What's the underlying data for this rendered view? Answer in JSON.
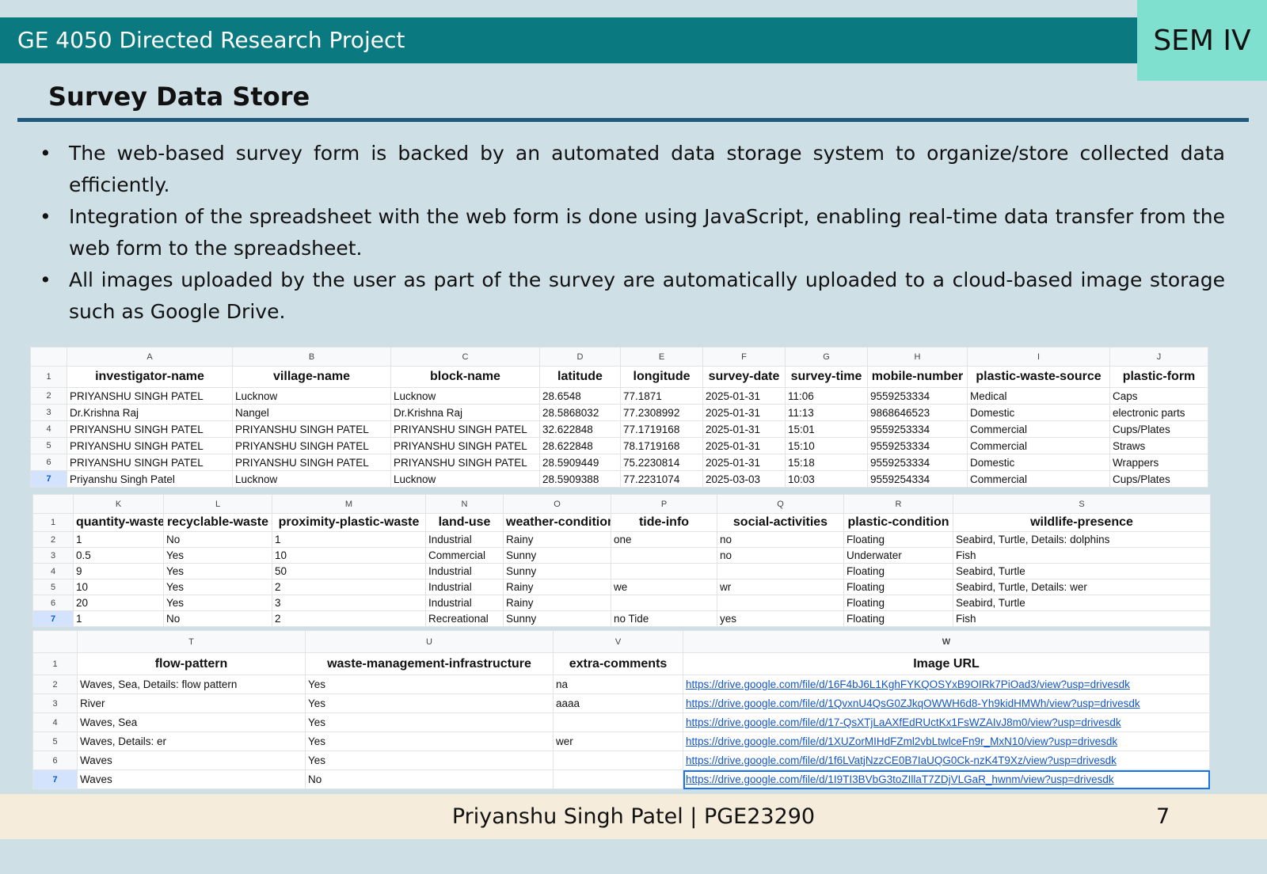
{
  "header": {
    "course": "GE 4050 Directed Research Project",
    "sem": "SEM IV"
  },
  "slide_title": "Survey Data Store",
  "bullets": [
    "The web-based survey form is backed by an automated data storage system to organize/store collected data efficiently.",
    "Integration of the spreadsheet with the web form is done using JavaScript, enabling real-time data transfer from the web form to the spreadsheet.",
    "All images uploaded by the user as part of the survey are automatically uploaded to a cloud-based image storage such as Google Drive."
  ],
  "bullet_char": "•",
  "sheet1": {
    "cols": [
      "A",
      "B",
      "C",
      "D",
      "E",
      "F",
      "G",
      "H",
      "I",
      "J"
    ],
    "headers": [
      "investigator-name",
      "village-name",
      "block-name",
      "latitude",
      "longitude",
      "survey-date",
      "survey-time",
      "mobile-number",
      "plastic-waste-source",
      "plastic-form"
    ],
    "rows": [
      [
        "PRIYANSHU SINGH PATEL",
        "Lucknow",
        "Lucknow",
        "28.6548",
        "77.1871",
        "2025-01-31",
        "11:06",
        "9559253334",
        "Medical",
        "Caps"
      ],
      [
        "Dr.Krishna Raj",
        "Nangel",
        "Dr.Krishna Raj",
        "28.5868032",
        "77.2308992",
        "2025-01-31",
        "11:13",
        "9868646523",
        "Domestic",
        "electronic parts"
      ],
      [
        "PRIYANSHU SINGH PATEL",
        "PRIYANSHU SINGH PATEL",
        "PRIYANSHU SINGH PATEL",
        "32.622848",
        "77.1719168",
        "2025-01-31",
        "15:01",
        "9559253334",
        "Commercial",
        "Cups/Plates"
      ],
      [
        "PRIYANSHU SINGH PATEL",
        "PRIYANSHU SINGH PATEL",
        "PRIYANSHU SINGH PATEL",
        "28.622848",
        "78.1719168",
        "2025-01-31",
        "15:10",
        "9559253334",
        "Commercial",
        "Straws"
      ],
      [
        "PRIYANSHU SINGH PATEL",
        "PRIYANSHU SINGH PATEL",
        "PRIYANSHU SINGH PATEL",
        "28.5909449",
        "75.2230814",
        "2025-01-31",
        "15:18",
        "9559253334",
        "Domestic",
        "Wrappers"
      ],
      [
        "Priyanshu Singh Patel",
        "Lucknow",
        "Lucknow",
        "28.5909388",
        "77.2231074",
        "2025-03-03",
        "10:03",
        "9559254334",
        "Commercial",
        "Cups/Plates"
      ]
    ]
  },
  "sheet2": {
    "cols": [
      "K",
      "L",
      "M",
      "N",
      "O",
      "P",
      "Q",
      "R",
      "S"
    ],
    "headers": [
      "quantity-waste",
      "recyclable-waste",
      "proximity-plastic-waste",
      "land-use",
      "weather-condition",
      "tide-info",
      "social-activities",
      "plastic-condition",
      "wildlife-presence"
    ],
    "rows": [
      [
        "1",
        "No",
        "1",
        "Industrial",
        "Rainy",
        "one",
        "no",
        "Floating",
        "Seabird, Turtle, Details: dolphins"
      ],
      [
        "0.5",
        "Yes",
        "10",
        "Commercial",
        "Sunny",
        "",
        "no",
        "Underwater",
        "Fish"
      ],
      [
        "9",
        "Yes",
        "50",
        "Industrial",
        "Sunny",
        "",
        "",
        "Floating",
        "Seabird, Turtle"
      ],
      [
        "10",
        "Yes",
        "2",
        "Industrial",
        "Rainy",
        "we",
        "wr",
        "Floating",
        "Seabird, Turtle, Details: wer"
      ],
      [
        "20",
        "Yes",
        "3",
        "Industrial",
        "Rainy",
        "",
        "",
        "Floating",
        "Seabird, Turtle"
      ],
      [
        "1",
        "No",
        "2",
        "Recreational",
        "Sunny",
        "no Tide",
        "yes",
        "Floating",
        "Fish"
      ]
    ]
  },
  "sheet3": {
    "cols": [
      "T",
      "U",
      "V",
      "W"
    ],
    "headers": [
      "flow-pattern",
      "waste-management-infrastructure",
      "extra-comments",
      "Image URL"
    ],
    "rows": [
      [
        "Waves, Sea, Details: flow pattern",
        "Yes",
        "na",
        "https://drive.google.com/file/d/16F4bJ6L1KghFYKQOSYxB9OIRk7PiOad3/view?usp=drivesdk"
      ],
      [
        "River",
        "Yes",
        "aaaa",
        "https://drive.google.com/file/d/1QvxnU4QsG0ZJkqOWWH6d8-Yh9kidHMWh/view?usp=drivesdk"
      ],
      [
        "Waves, Sea",
        "Yes",
        "",
        "https://drive.google.com/file/d/17-QsXTjLaAXfEdRUctKx1FsWZAIvJ8m0/view?usp=drivesdk"
      ],
      [
        "Waves, Details: er",
        "Yes",
        "wer",
        "https://drive.google.com/file/d/1XUZorMIHdFZml2vbLtwlceFn9r_MxN10/view?usp=drivesdk"
      ],
      [
        "Waves",
        "Yes",
        "",
        "https://drive.google.com/file/d/1f6LVatjNzzCE0B7IaUQG0Ck-nzK4T9Xz/view?usp=drivesdk"
      ],
      [
        "Waves",
        "No",
        "",
        "https://drive.google.com/file/d/1I9TI3BVbG3toZIllaT7ZDjVLGaR_hwnm/view?usp=drivesdk"
      ]
    ]
  },
  "row_numbers": [
    "1",
    "2",
    "3",
    "4",
    "5",
    "6",
    "7"
  ],
  "footer": {
    "author": "Priyanshu Singh Patel | PGE23290",
    "page": "7"
  }
}
